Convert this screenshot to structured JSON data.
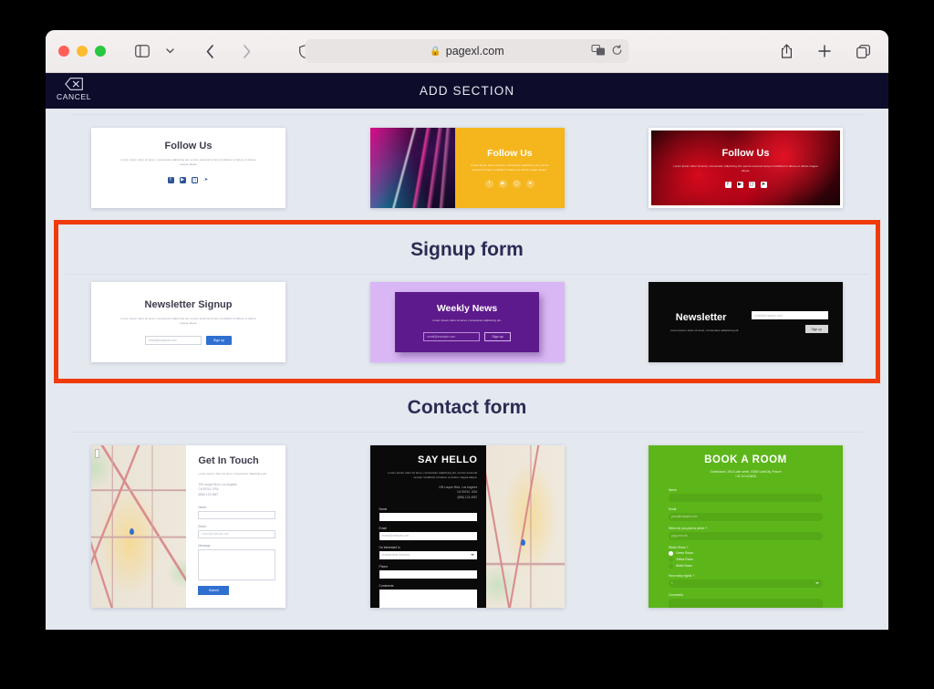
{
  "browser": {
    "url": "pagexl.com",
    "lock_icon": "lock-icon",
    "translate_icon": "translate-icon",
    "reload_icon": "reload-icon",
    "back_icon": "back-chevron-icon",
    "forward_icon": "forward-chevron-icon",
    "sidebar_icon": "sidebar-toggle-icon",
    "sidebar_chevron_icon": "chevron-down-icon",
    "shield_icon": "privacy-shield-icon",
    "share_icon": "share-icon",
    "new_tab_icon": "plus-icon",
    "tab_overview_icon": "tab-overview-icon"
  },
  "appbar": {
    "cancel_label": "CANCEL",
    "cancel_icon": "delete-x-icon",
    "title": "ADD SECTION"
  },
  "colors": {
    "page_background": "#e4e8ef",
    "appbar_background": "#0d0d2b",
    "highlight_border": "#ef3b0c",
    "section_title": "#2b2b55",
    "accent_blue": "#2f6fd0",
    "yellow_card": "#f5b51c",
    "purple_card": "#5d1a8c",
    "purple_card_bg": "#d9b7f5",
    "green_card": "#5cb61a",
    "black_card": "#0a0a0a"
  },
  "sections": [
    {
      "id": "follow-us",
      "title": "",
      "highlighted": false,
      "cards": [
        {
          "id": "follow-us-white",
          "heading": "Follow Us",
          "body": "Lorem ipsum dolor sit amet, consectetur adipiscing elit, sed do eiusmod tempor incididunt ut labore et dolore magna aliqua.",
          "socials": [
            "facebook",
            "youtube",
            "instagram",
            "twitter"
          ]
        },
        {
          "id": "follow-us-yellow",
          "heading": "Follow Us",
          "body": "Lorem ipsum dolor sit amet, consectetur adipiscing elit, sed do eiusmod tempor incididunt ut labore et dolore magna aliqua.",
          "socials": [
            "facebook",
            "youtube",
            "instagram",
            "twitter"
          ],
          "image": "neon-city-street-photo"
        },
        {
          "id": "follow-us-red",
          "heading": "Follow Us",
          "body": "Lorem ipsum dolor sit amet, consectetur adipiscing elit, sed do eiusmod tempor incididunt ut labore et dolore magna aliqua.",
          "socials": [
            "facebook",
            "youtube",
            "instagram",
            "twitter"
          ],
          "image": "red-abstract-smoke-photo"
        }
      ]
    },
    {
      "id": "signup-form",
      "title": "Signup form",
      "highlighted": true,
      "cards": [
        {
          "id": "newsletter-signup-white",
          "heading": "Newsletter Signup",
          "body": "Lorem ipsum dolor sit amet, consectetur adipiscing elit, sed do eiusmod tempor incididunt ut labore et dolore magna aliqua.",
          "email_placeholder": "email@example.com",
          "button_label": "Sign up"
        },
        {
          "id": "weekly-news-purple",
          "heading": "Weekly News",
          "body": "Lorem ipsum dolor sit amet, consectetur adipiscing elit.",
          "email_placeholder": "email@example.com",
          "button_label": "Sign up"
        },
        {
          "id": "newsletter-black",
          "heading": "Newsletter",
          "body": "Lorem ipsum dolor sit amet, consectetur adipiscing elit.",
          "email_placeholder": "email@example.com",
          "button_label": "Sign up"
        }
      ]
    },
    {
      "id": "contact-form",
      "title": "Contact form",
      "highlighted": false,
      "cards": [
        {
          "id": "get-in-touch",
          "heading": "Get In Touch",
          "body": "Lorem ipsum dolor sit amet, consectetur adipiscing elit.",
          "address": "199 Lauper Blvd, Los Angeles\nCA 90210, USA\n(888) 123-4567",
          "fields": [
            {
              "label": "Name",
              "placeholder": ""
            },
            {
              "label": "Email",
              "placeholder": "inbox@example.com"
            },
            {
              "label": "Message",
              "placeholder": ""
            }
          ],
          "button_label": "Submit",
          "image": "street-map"
        },
        {
          "id": "say-hello",
          "heading": "SAY HELLO",
          "body": "Lorem ipsum dolor sit amet, consectetur adipiscing elit, sed do eiusmod tempor incididunt ut labore et dolore magna aliqua.",
          "address": "199 Lauper Blvd, Los Angeles\nCA 90210, USA\n(888) 123-4567",
          "fields": [
            {
              "label": "Name",
              "placeholder": ""
            },
            {
              "label": "Email",
              "placeholder": "email@example.com"
            },
            {
              "label": "I'm interested in",
              "placeholder": "Architectural Services"
            },
            {
              "label": "Phone",
              "placeholder": ""
            },
            {
              "label": "Comments",
              "placeholder": ""
            }
          ],
          "image": "street-map"
        },
        {
          "id": "book-a-room",
          "heading": "BOOK A ROOM",
          "address": "Guesthouse, 1914 Lake street, 03080 LakeCity, France\n+33 110 624818",
          "fields": [
            {
              "label": "Name",
              "placeholder": ""
            },
            {
              "label": "Email",
              "placeholder": "your@example.com"
            },
            {
              "label": "When do you plan to arrive ?",
              "placeholder": "yyyy-mm-dd"
            },
            {
              "label": "Which Room ?",
              "placeholder": ""
            },
            {
              "label": "How many nights ?",
              "placeholder": "1"
            },
            {
              "label": "Comments",
              "placeholder": ""
            }
          ],
          "radios": [
            {
              "label": "Green Room",
              "selected": true
            },
            {
              "label": "Yellow Room",
              "selected": false
            },
            {
              "label": "White Room",
              "selected": false
            }
          ]
        }
      ]
    }
  ]
}
